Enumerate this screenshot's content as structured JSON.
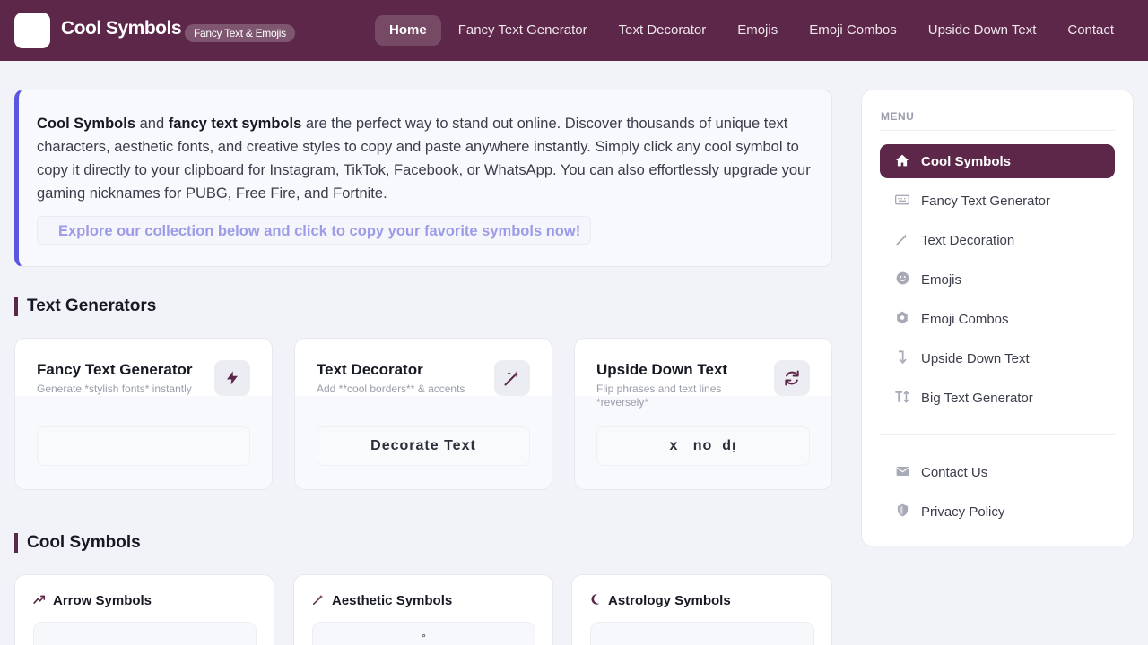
{
  "header": {
    "brand": "Cool Symbols",
    "badge": "Fancy Text & Emojis",
    "nav": [
      {
        "label": "Home",
        "active": true
      },
      {
        "label": "Fancy Text Generator"
      },
      {
        "label": "Text Decorator"
      },
      {
        "label": "Emojis"
      },
      {
        "label": "Emoji Combos"
      },
      {
        "label": "Upside Down Text"
      },
      {
        "label": "Contact"
      }
    ]
  },
  "intro": {
    "bold1": "Cool Symbols",
    "and": " and ",
    "bold2": "fancy text symbols",
    "body": " are the perfect way to stand out online. Discover thousands of unique text characters, aesthetic fonts, and creative styles to copy and paste anywhere instantly. Simply click any cool symbol to copy it directly to your clipboard for Instagram, TikTok, Facebook, or WhatsApp. You can also effortlessly upgrade your gaming nicknames for PUBG, Free Fire, and Fortnite.",
    "cta": "Explore our collection below and click to copy your favorite symbols now!"
  },
  "sections": {
    "generators": "Text Generators",
    "symbols": "Cool Symbols"
  },
  "generators": [
    {
      "title": "Fancy Text Generator",
      "subtitle": "Generate *stylish fonts* instantly",
      "icon": "bolt-icon",
      "preview": ""
    },
    {
      "title": "Text Decorator",
      "subtitle": "Add **cool borders** & accents",
      "icon": "magic-wand-icon",
      "preview": "Decorate Text"
    },
    {
      "title": "Upside Down Text",
      "subtitle": "Flip phrases and text lines *reversely*",
      "icon": "refresh-icon",
      "preview": "x   no  dı̣"
    }
  ],
  "symbol_cards": [
    {
      "title": "Arrow Symbols",
      "icon": "trend-arrow-icon",
      "preview": ""
    },
    {
      "title": "Aesthetic Symbols",
      "icon": "magic-wand-icon",
      "preview": "°"
    },
    {
      "title": "Astrology Symbols",
      "icon": "moon-icon",
      "preview": ""
    }
  ],
  "sidebar": {
    "menu_label": "MENU",
    "items": [
      {
        "label": "Cool Symbols",
        "icon": "home-icon",
        "active": true
      },
      {
        "label": "Fancy Text Generator",
        "icon": "keyboard-icon"
      },
      {
        "label": "Text Decoration",
        "icon": "magic-wand-icon"
      },
      {
        "label": "Emojis",
        "icon": "smiley-icon"
      },
      {
        "label": "Emoji Combos",
        "icon": "gear-icon"
      },
      {
        "label": "Upside Down Text",
        "icon": "turn-down-arrow-icon"
      },
      {
        "label": "Big Text Generator",
        "icon": "text-height-icon"
      }
    ],
    "secondary": [
      {
        "label": "Contact Us",
        "icon": "envelope-icon"
      },
      {
        "label": "Privacy Policy",
        "icon": "shield-icon"
      }
    ]
  },
  "colors": {
    "brand": "#5c2748",
    "accent": "#5b55e0",
    "background": "#f1f3f8"
  }
}
